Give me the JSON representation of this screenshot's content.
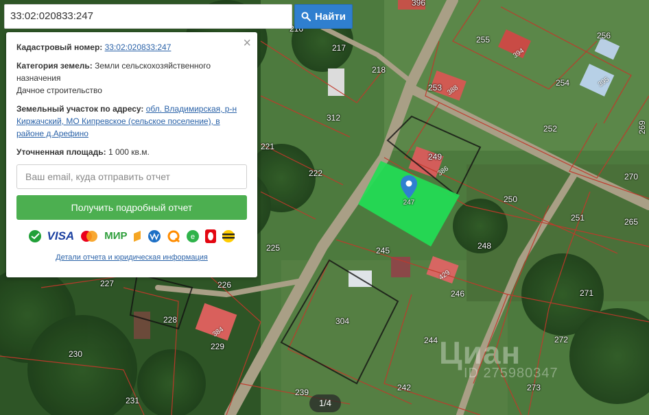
{
  "search": {
    "value": "33:02:020833:247",
    "button_label": "Найти"
  },
  "popup": {
    "cadastral_label": "Кадастровый номер:",
    "cadastral_value": "33:02:020833:247",
    "category_label": "Категория земель:",
    "category_value": "Земли сельскохозяйственного назначения",
    "category_use": "Дачное строительство",
    "address_label": "Земельный участок по адресу:",
    "address_value": "обл. Владимирская, р-н Киржачский, МО Кипревское (сельское поселение), в районе д.Арефино",
    "area_label": "Уточненная площадь:",
    "area_value": "1 000 кв.м.",
    "email_placeholder": "Ваш email, куда отправить отчет",
    "report_button": "Получить подробный отчет",
    "payment_methods": [
      "sberbank-icon",
      "VISA",
      "mastercard-icon",
      "МИР",
      "yandex-money-icon",
      "webmoney-icon",
      "qiwi-icon",
      "e-pos-icon",
      "mts-icon",
      "beeline-icon"
    ],
    "details_link": "Детали отчета и юридическая информация"
  },
  "map": {
    "parcel_numbers": [
      "396",
      "216",
      "217",
      "218",
      "255",
      "394",
      "256",
      "395",
      "253",
      "388",
      "254",
      "312",
      "252",
      "269",
      "221",
      "249",
      "386",
      "222",
      "270",
      "250",
      "251",
      "265",
      "225",
      "245",
      "248",
      "227",
      "226",
      "429",
      "246",
      "271",
      "228",
      "304",
      "384",
      "229",
      "244",
      "272",
      "230",
      "239",
      "242",
      "273",
      "231"
    ],
    "selected_parcel": "247",
    "watermark": "Циан",
    "watermark_id": "ID 275980347",
    "colors": {
      "boundary": "#c0392b",
      "selected_parcel": "#22dd55",
      "pin": "#2f80d0"
    }
  },
  "pager": {
    "label": "1/4"
  }
}
